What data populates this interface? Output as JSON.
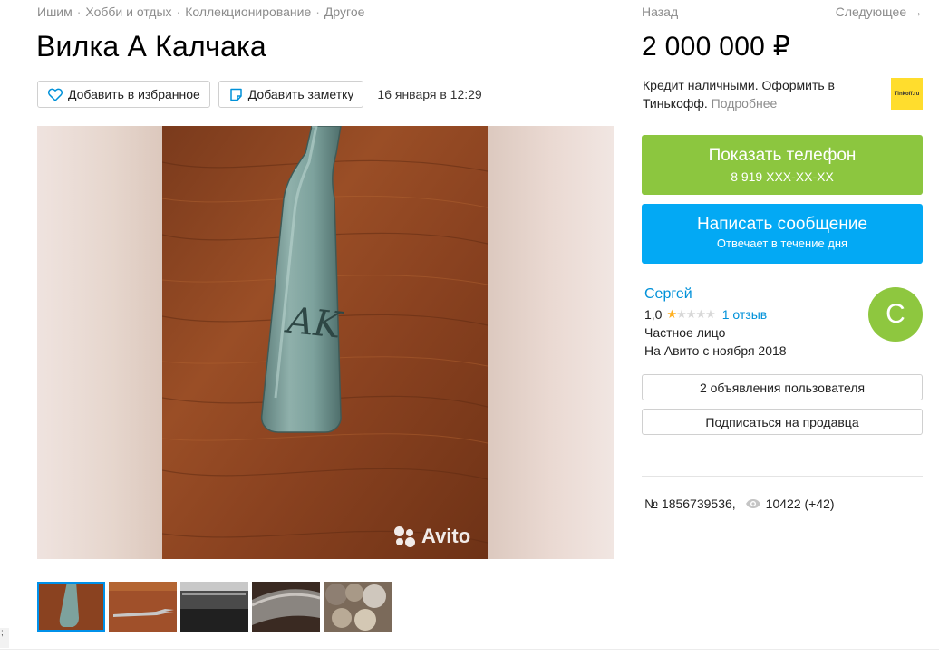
{
  "breadcrumb": [
    "Ишим",
    "Хобби и отдых",
    "Коллекционирование",
    "Другое"
  ],
  "breadcrumb_sep": "·",
  "title": "Вилка А Калчака",
  "actions": {
    "favorite_label": "Добавить в избранное",
    "note_label": "Добавить заметку",
    "date": "16 января в 12:29"
  },
  "gallery": {
    "watermark": "Avito",
    "engraving": "AK",
    "thumbnail_count": 5,
    "active_thumbnail": 1
  },
  "nav": {
    "prev_label": "Назад",
    "next_label": "Следующее →"
  },
  "price": "2 000 000 ₽",
  "credit": {
    "text": "Кредит наличными. Оформить в Тинькофф.",
    "more_label": "Подробнее",
    "partner_logo": "Tinkoff.ru"
  },
  "phone_button": {
    "title": "Показать телефон",
    "subtitle": "8 919 XXX-XX-XX"
  },
  "message_button": {
    "title": "Написать сообщение",
    "subtitle": "Отвечает в течение дня"
  },
  "seller": {
    "name": "Сергей",
    "rating": "1,0",
    "stars_filled": 1,
    "stars_total": 5,
    "reviews_label": "1 отзыв",
    "type": "Частное лицо",
    "since": "На Авито с ноября 2018",
    "avatar_letter": "С"
  },
  "ads_button": "2 объявления пользователя",
  "subscribe_button": "Подписаться на продавца",
  "item_number": "№ 1856739536,",
  "views": "10422 (+42)",
  "edge_mark": ";",
  "colors": {
    "green": "#8cc63f",
    "blue": "#03a9f4",
    "link": "#0091d9",
    "star": "#ffb021",
    "tinkoff": "#ffdd2d"
  }
}
